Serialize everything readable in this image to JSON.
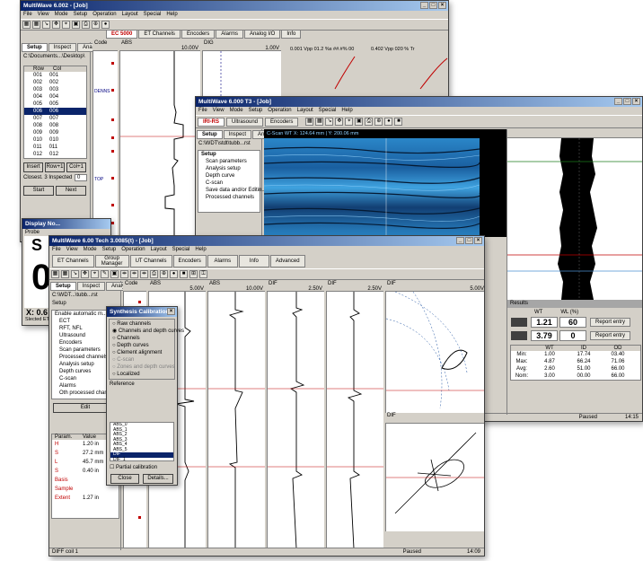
{
  "win1": {
    "title": "MultiWave 6.002 - [Job]",
    "menu": [
      "File",
      "View",
      "Mode",
      "Setup",
      "Operation",
      "Layout",
      "Special",
      "Help"
    ],
    "tabs": [
      "EC 5000",
      "ET Channels",
      "Encoders",
      "Alarms",
      "Analog I/O",
      "Info"
    ],
    "side_tabs": [
      "Setup",
      "Inspect",
      "Analysis"
    ],
    "path": "C:\\Documents...\\Desktop\\",
    "list_headers": [
      "Row",
      "Col"
    ],
    "rows": [
      "001",
      "002",
      "003",
      "004",
      "005",
      "006",
      "007",
      "008",
      "009",
      "010",
      "011",
      "012"
    ],
    "selected_index": 5,
    "buttons": [
      "Insert",
      "Row+1",
      "Col+1"
    ],
    "closest_label": "Closest. 3 Inspected",
    "closest_value": "0",
    "start_label": "Start",
    "next_label": "Next",
    "code_header": "Code",
    "code_labels": [
      "DENNS",
      "TOP"
    ],
    "track1_name": "ABS",
    "track1_scale": "10.00V",
    "track2_name": "DIG",
    "track2_scale": "1.00V",
    "info1": "0.001 Vpp  01.2 %s  ##.#%  00",
    "info2": "0.402 Vpp  020 %  Tr"
  },
  "win2": {
    "title": "MultiWave 6.000 T3 - [Job]",
    "menu": [
      "File",
      "View",
      "Mode",
      "Setup",
      "Operation",
      "Layout",
      "Special",
      "Help"
    ],
    "tabs": [
      "IRI-RS",
      "Ultrasound",
      "Encoders"
    ],
    "side_tabs": [
      "Setup",
      "Inspect",
      "Analysis"
    ],
    "path": "C:\\WDT\\stdt\\tubb...rst",
    "setup_items": [
      "Setup",
      "Scan parameters",
      "Analysis setup",
      "Depth curve",
      "C-scan",
      "Save data and/or Editin...",
      "Processed channels"
    ],
    "cscan_header": "C-Scan  WT   X: 124.64 mm  |  Y: 200.06 mm",
    "results_title": "Results",
    "results_cols": [
      "",
      "WT",
      "WL (%)"
    ],
    "big_values": [
      {
        "wt": "1.21",
        "pct": "60",
        "btn": "Report entry"
      },
      {
        "wt": "3.79",
        "pct": "0",
        "btn": "Report entry"
      }
    ],
    "stats_cols": [
      "",
      "WT",
      "ID",
      "OD"
    ],
    "stats": [
      [
        "Min:",
        "1.00",
        "17.74",
        "03.40"
      ],
      [
        "Max:",
        "4.87",
        "66.24",
        "71.06"
      ],
      [
        "Avg:",
        "2.60",
        "51.00",
        "66.00"
      ],
      [
        "Nom:",
        "3.00",
        "00.00",
        "66.00"
      ]
    ],
    "status_mode": "Paused",
    "status_time": "14:15"
  },
  "win3": {
    "title": "MultiWave 6.00 Tech 3.0085(t) - [Job]",
    "menu": [
      "File",
      "View",
      "Mode",
      "Setup",
      "Operation",
      "Layout",
      "Special",
      "Help"
    ],
    "tabs": [
      "ET Channels",
      "Group Manager",
      "UT Channels",
      "Encoders",
      "Alarms",
      "Info",
      "Advanced"
    ],
    "side_tabs": [
      "Setup",
      "Inspect",
      "Analysis"
    ],
    "path": "C:\\WDT...\\tubb...rst",
    "setup_header": "Setup",
    "setup_items": [
      "Enable automatic m...",
      "ECT",
      "RFT, NFL",
      "Ultrasound",
      "Encoders",
      "Scan parameters",
      "Processed channels",
      "Analysis setup",
      "Depth curves",
      "C-scan",
      "Alarms",
      "Oth processed chan..."
    ],
    "edit_label": "Edit",
    "param_headers": [
      "Param.",
      "Value"
    ],
    "params": [
      [
        "H",
        "1.20 in"
      ],
      [
        "S",
        "27.2 mm"
      ],
      [
        "L",
        "45.7 mm"
      ],
      [
        "S",
        "0.40 in"
      ],
      [
        "Basis",
        ""
      ],
      [
        "Sample",
        ""
      ],
      [
        "Extent",
        "1.27 in"
      ]
    ],
    "code_header": "Code",
    "tracks": [
      {
        "name": "ABS",
        "scale": "5.00V"
      },
      {
        "name": "ABS",
        "scale": "10.00V"
      },
      {
        "name": "DIF",
        "scale": "2.50V"
      },
      {
        "name": "DIF",
        "scale": "2.50V"
      },
      {
        "name": "DIF",
        "scale": "5.00V"
      }
    ],
    "dif_label": "DIF",
    "status_left": "DIFF coil 1",
    "status_mode": "Paused",
    "status_time": "14:09"
  },
  "dialog": {
    "title": "Synthesis Calibration",
    "options": [
      "Raw channels",
      "Channels and depth curves",
      "Channels",
      "Depth curves",
      "Clement alignment",
      "C-scan",
      "Zones and depth curves",
      "Localized"
    ],
    "selected_option": 1,
    "reference_label": "Reference",
    "references": [
      "ABS_0",
      "ABS_1",
      "ABS_2",
      "ABS_3",
      "ABS_4",
      "ABS_5",
      "DIF",
      "DIF_1"
    ],
    "selected_reference": 6,
    "partial_label": "Partial calibration",
    "close_label": "Close",
    "details_label": "Details..."
  },
  "popup": {
    "title": "Display No...",
    "subtitle": "Probe",
    "big_char": "S",
    "big_digit": "0",
    "coord": "X: 0.6",
    "footer": "Slected ET Se..."
  },
  "colors": {
    "titlebar": "#0a246a",
    "accent_red": "#c00000",
    "cscan_blue": "#1a6fb0",
    "selection": "#0a246a"
  }
}
